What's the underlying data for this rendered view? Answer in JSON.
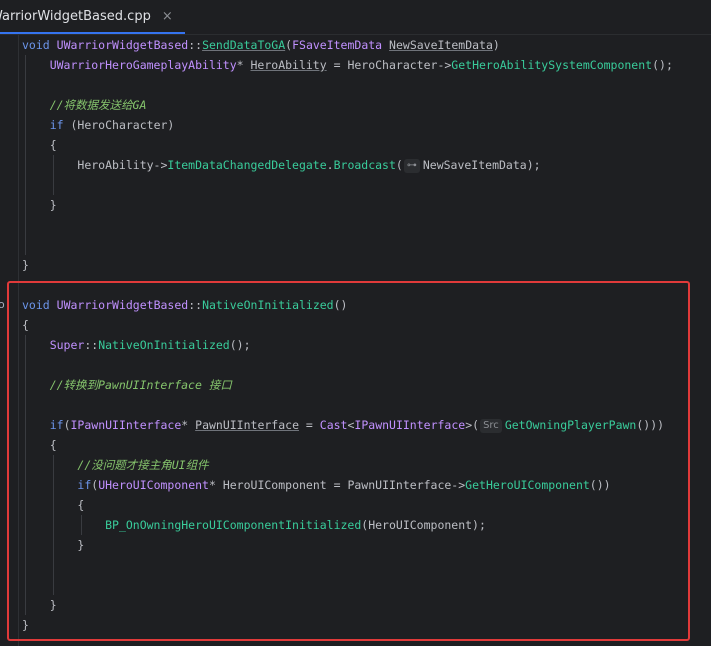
{
  "tab": {
    "title": "WarriorWidgetBased.cpp",
    "close_glyph": "×"
  },
  "gutter": {
    "marker_glyph": "o"
  },
  "code": {
    "l1": {
      "kw": "void",
      "cls": "UWarriorWidgetBased",
      "sep": "::",
      "fn": "SendDataToGA",
      "p1": "(",
      "type": "FSaveItemData",
      "sp": " ",
      "param": "NewSaveItemData",
      "p2": ")"
    },
    "l2": {
      "type": "UWarriorHeroGameplayAbility",
      "mid": "* ",
      "var": "HeroAbility",
      "eq": " = HeroCharacter->",
      "fn": "GetHeroAbilitySystemComponent",
      "end": "();"
    },
    "l3": {
      "comment": "//将数据发送给GA"
    },
    "l4": {
      "kw": "if",
      "rest": " (HeroCharacter)"
    },
    "l5": {
      "text": "{"
    },
    "l6": {
      "obj": "HeroAbility->",
      "prop": "ItemDataChangedDelegate",
      "dot": ".",
      "fn": "Broadcast",
      "p1": "(",
      "hint": "⊶",
      "arg": "NewSaveItemData",
      "end": ");"
    },
    "l7": {
      "text": "}"
    },
    "l8": {
      "text": "}"
    },
    "l9": {
      "kw": "void",
      "cls": "UWarriorWidgetBased",
      "sep": "::",
      "fn": "NativeOnInitialized",
      "end": "()"
    },
    "l10": {
      "text": "{"
    },
    "l11": {
      "type": "Super",
      "sep": "::",
      "fn": "NativeOnInitialized",
      "end": "();"
    },
    "l12": {
      "comment": "//转换到PawnUIInterface 接口"
    },
    "l13": {
      "kw": "if",
      "p1": "(",
      "type": "IPawnUIInterface",
      "star": "* ",
      "var": "PawnUIInterface",
      "eq": " = ",
      "cast": "Cast",
      "lt": "<",
      "type2": "IPawnUIInterface",
      "gt": ">(",
      "hint": "Src",
      "fn": "GetOwningPlayerPawn",
      "end": "()))"
    },
    "l14": {
      "text": "{"
    },
    "l15": {
      "comment": "//没问题才接主角UI组件"
    },
    "l16": {
      "kw": "if",
      "p1": "(",
      "type": "UHeroUIComponent",
      "star": "* ",
      "var": "HeroUIComponent",
      "eq": " = PawnUIInterface->",
      "fn": "GetHeroUIComponent",
      "end": "())"
    },
    "l17": {
      "text": "{"
    },
    "l18": {
      "fn": "BP_OnOwningHeroUIComponentInitialized",
      "end": "(HeroUIComponent);"
    },
    "l19": {
      "text": "}"
    },
    "l20": {
      "text": "}"
    },
    "l21": {
      "text": "}"
    }
  },
  "colors": {
    "background": "#1e1f22",
    "keyword": "#6c95eb",
    "type": "#c191ff",
    "function": "#39cc9b",
    "comment": "#85c46c",
    "highlight_box": "#e03a3a"
  }
}
